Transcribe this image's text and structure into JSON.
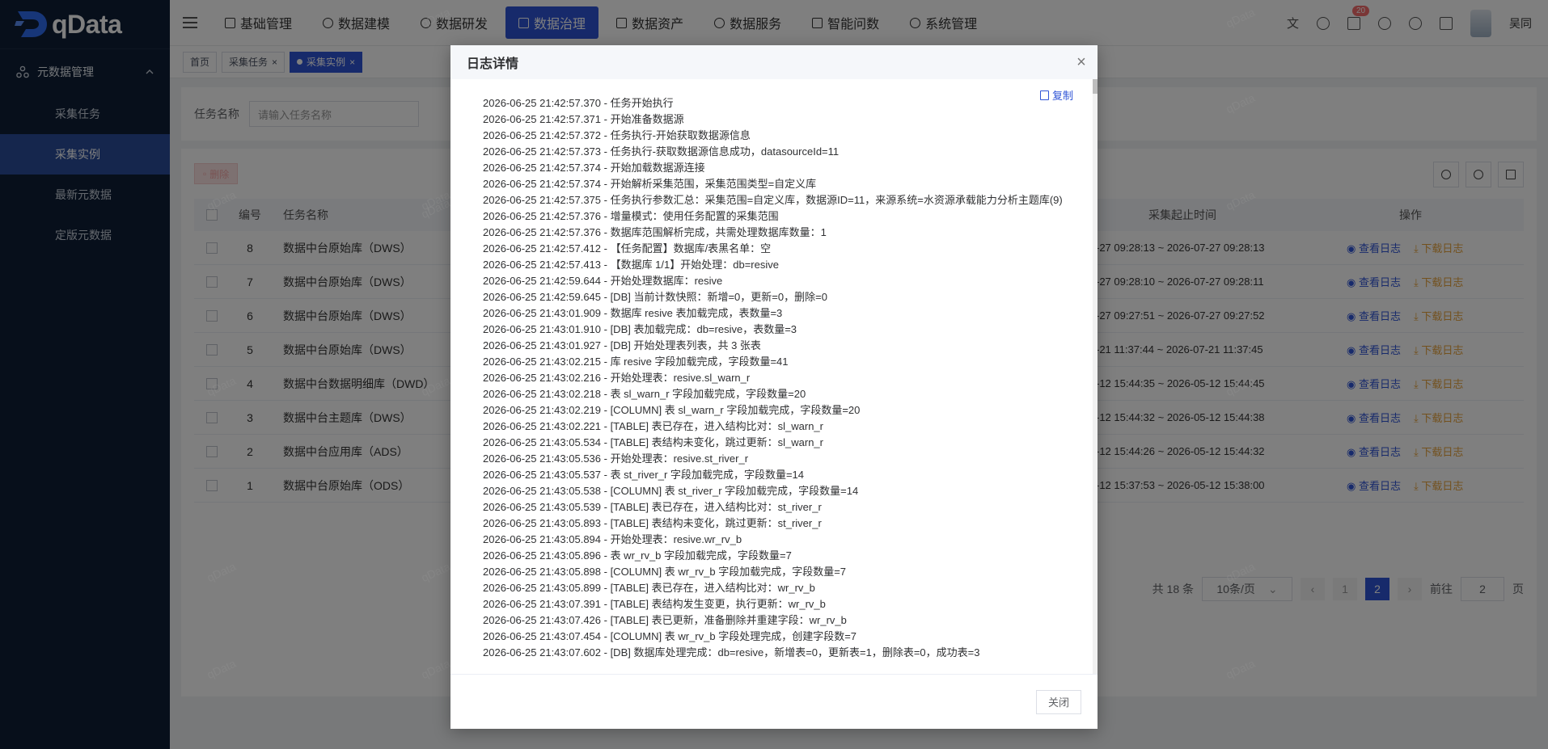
{
  "app": {
    "name": "qData",
    "username": "吴同",
    "notification_count": "20"
  },
  "sidebar": {
    "group_label": "元数据管理",
    "items": [
      {
        "label": "采集任务"
      },
      {
        "label": "采集实例"
      },
      {
        "label": "最新元数据"
      },
      {
        "label": "定版元数据"
      }
    ]
  },
  "topnav": {
    "items": [
      {
        "label": "基础管理"
      },
      {
        "label": "数据建模"
      },
      {
        "label": "数据研发"
      },
      {
        "label": "数据治理"
      },
      {
        "label": "数据资产"
      },
      {
        "label": "数据服务"
      },
      {
        "label": "智能问数"
      },
      {
        "label": "系统管理"
      }
    ],
    "active": "数据治理"
  },
  "tags": [
    {
      "label": "首页"
    },
    {
      "label": "采集任务"
    },
    {
      "label": "采集实例"
    }
  ],
  "search": {
    "label": "任务名称",
    "placeholder": "请输入任务名称"
  },
  "toolbar": {
    "delete_label": "删除"
  },
  "table": {
    "headers": {
      "no": "编号",
      "name": "任务名称",
      "time": "采集起止时间",
      "op": "操作"
    },
    "view_label": "查看日志",
    "download_label": "下载日志",
    "rows": [
      {
        "no": "8",
        "name": "数据中台原始库（DWS）",
        "time": "-27 09:28:13 ~ 2026-07-27 09:28:13"
      },
      {
        "no": "7",
        "name": "数据中台原始库（DWS）",
        "time": "-27 09:28:10 ~ 2026-07-27 09:28:11"
      },
      {
        "no": "6",
        "name": "数据中台原始库（DWS）",
        "time": "-27 09:27:51 ~ 2026-07-27 09:27:52"
      },
      {
        "no": "5",
        "name": "数据中台原始库（DWS）",
        "time": "-21 11:37:44 ~ 2026-07-21 11:37:45"
      },
      {
        "no": "4",
        "name": "数据中台数据明细库（DWD）",
        "time": "-12 15:44:35 ~ 2026-05-12 15:44:45"
      },
      {
        "no": "3",
        "name": "数据中台主题库（DWS）",
        "time": "-12 15:44:32 ~ 2026-05-12 15:44:38"
      },
      {
        "no": "2",
        "name": "数据中台应用库（ADS）",
        "time": "-12 15:44:26 ~ 2026-05-12 15:44:32"
      },
      {
        "no": "1",
        "name": "数据中台原始库（ODS）",
        "time": "-12 15:37:53 ~ 2026-05-12 15:38:00"
      }
    ]
  },
  "pagination": {
    "total": "共 18 条",
    "page_size": "10条/页",
    "pages": [
      "1",
      "2"
    ],
    "current": "2",
    "goto_label": "前往",
    "goto_value": "2",
    "page_unit": "页"
  },
  "watermark": "qData",
  "dialog": {
    "title": "日志详情",
    "copy_label": "复制",
    "close_label": "关闭",
    "log_lines": [
      "2026-06-25 21:42:57.370 - 任务开始执行",
      "2026-06-25 21:42:57.371 - 开始准备数据源",
      "2026-06-25 21:42:57.372 - 任务执行-开始获取数据源信息",
      "2026-06-25 21:42:57.373 - 任务执行-获取数据源信息成功，datasourceId=11",
      "2026-06-25 21:42:57.374 - 开始加载数据源连接",
      "2026-06-25 21:42:57.374 - 开始解析采集范围，采集范围类型=自定义库",
      "2026-06-25 21:42:57.375 - 任务执行参数汇总：采集范围=自定义库，数据源ID=11，来源系统=水资源承载能力分析主题库(9)",
      "2026-06-25 21:42:57.376 - 增量模式：使用任务配置的采集范围",
      "2026-06-25 21:42:57.376 - 数据库范围解析完成，共需处理数据库数量：1",
      "2026-06-25 21:42:57.412 - 【任务配置】数据库/表黑名单：空",
      "2026-06-25 21:42:57.413 - 【数据库 1/1】开始处理：db=resive",
      "2026-06-25 21:42:59.644 - 开始处理数据库：resive",
      "2026-06-25 21:42:59.645 - [DB] 当前计数快照：新增=0，更新=0，删除=0",
      "2026-06-25 21:43:01.909 - 数据库 resive 表加载完成，表数量=3",
      "2026-06-25 21:43:01.910 - [DB] 表加载完成：db=resive，表数量=3",
      "2026-06-25 21:43:01.927 - [DB] 开始处理表列表，共 3 张表",
      "2026-06-25 21:43:02.215 - 库 resive 字段加载完成，字段数量=41",
      "2026-06-25 21:43:02.216 - 开始处理表：resive.sl_warn_r",
      "2026-06-25 21:43:02.218 - 表 sl_warn_r 字段加载完成，字段数量=20",
      "2026-06-25 21:43:02.219 - [COLUMN] 表 sl_warn_r 字段加载完成，字段数量=20",
      "2026-06-25 21:43:02.221 - [TABLE] 表已存在，进入结构比对：sl_warn_r",
      "2026-06-25 21:43:05.534 - [TABLE] 表结构未变化，跳过更新：sl_warn_r",
      "2026-06-25 21:43:05.536 - 开始处理表：resive.st_river_r",
      "2026-06-25 21:43:05.537 - 表 st_river_r 字段加载完成，字段数量=14",
      "2026-06-25 21:43:05.538 - [COLUMN] 表 st_river_r 字段加载完成，字段数量=14",
      "2026-06-25 21:43:05.539 - [TABLE] 表已存在，进入结构比对：st_river_r",
      "2026-06-25 21:43:05.893 - [TABLE] 表结构未变化，跳过更新：st_river_r",
      "2026-06-25 21:43:05.894 - 开始处理表：resive.wr_rv_b",
      "2026-06-25 21:43:05.896 - 表 wr_rv_b 字段加载完成，字段数量=7",
      "2026-06-25 21:43:05.898 - [COLUMN] 表 wr_rv_b 字段加载完成，字段数量=7",
      "2026-06-25 21:43:05.899 - [TABLE] 表已存在，进入结构比对：wr_rv_b",
      "2026-06-25 21:43:07.391 - [TABLE] 表结构发生变更，执行更新：wr_rv_b",
      "2026-06-25 21:43:07.426 - [TABLE] 表已更新，准备删除并重建字段：wr_rv_b",
      "2026-06-25 21:43:07.454 - [COLUMN] 表 wr_rv_b 字段处理完成，创建字段数=7",
      "2026-06-25 21:43:07.602 - [DB] 数据库处理完成：db=resive，新增表=0，更新表=1，删除表=0，成功表=3"
    ]
  }
}
